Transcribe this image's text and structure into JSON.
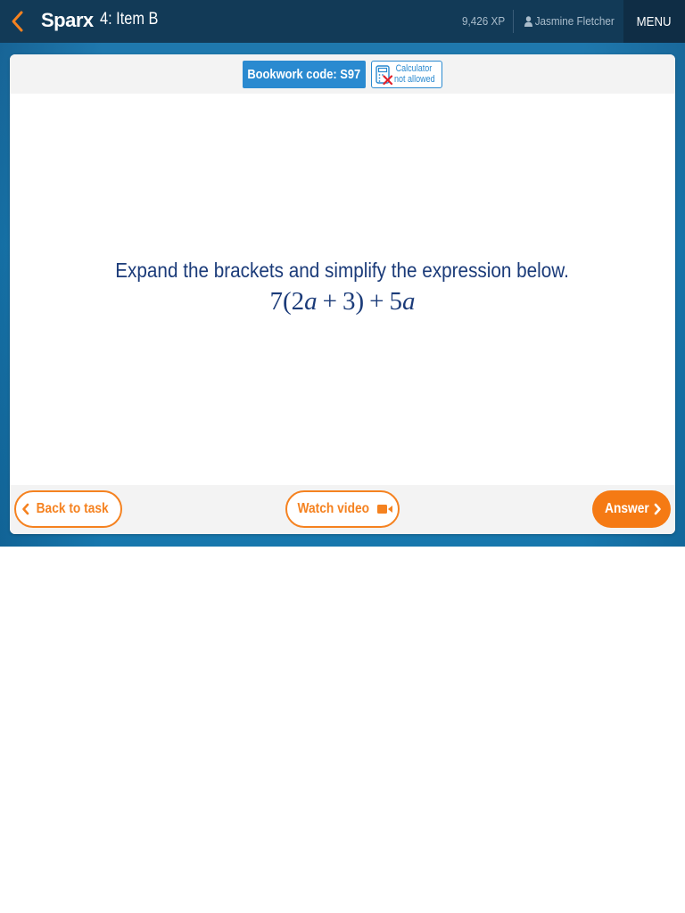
{
  "topbar": {
    "logo": "Sparx",
    "item_title": "4: Item B",
    "xp": "9,426 XP",
    "user_name": "Jasmine Fletcher",
    "menu_label": "MENU"
  },
  "question_card": {
    "bookwork_code": "Bookwork code: S97",
    "calculator_line1": "Calculator",
    "calculator_line2": "not allowed",
    "prompt": "Expand the brackets and simplify the expression below.",
    "expression": "7(2a + 3) + 5a"
  },
  "footer": {
    "back_label": "Back to task",
    "video_label": "Watch video",
    "answer_label": "Answer"
  },
  "icons": {
    "back": "chevron-left-icon",
    "user": "user-icon",
    "calculator": "calculator-not-allowed-icon",
    "video": "video-camera-icon",
    "answer": "chevron-right-icon"
  },
  "colors": {
    "topbar": "#123a57",
    "menu": "#0f2d45",
    "accent_orange": "#f58220",
    "bookwork_blue": "#2a8ad0",
    "text_navy": "#1b3b79",
    "background_blue": "#1c86bf"
  }
}
